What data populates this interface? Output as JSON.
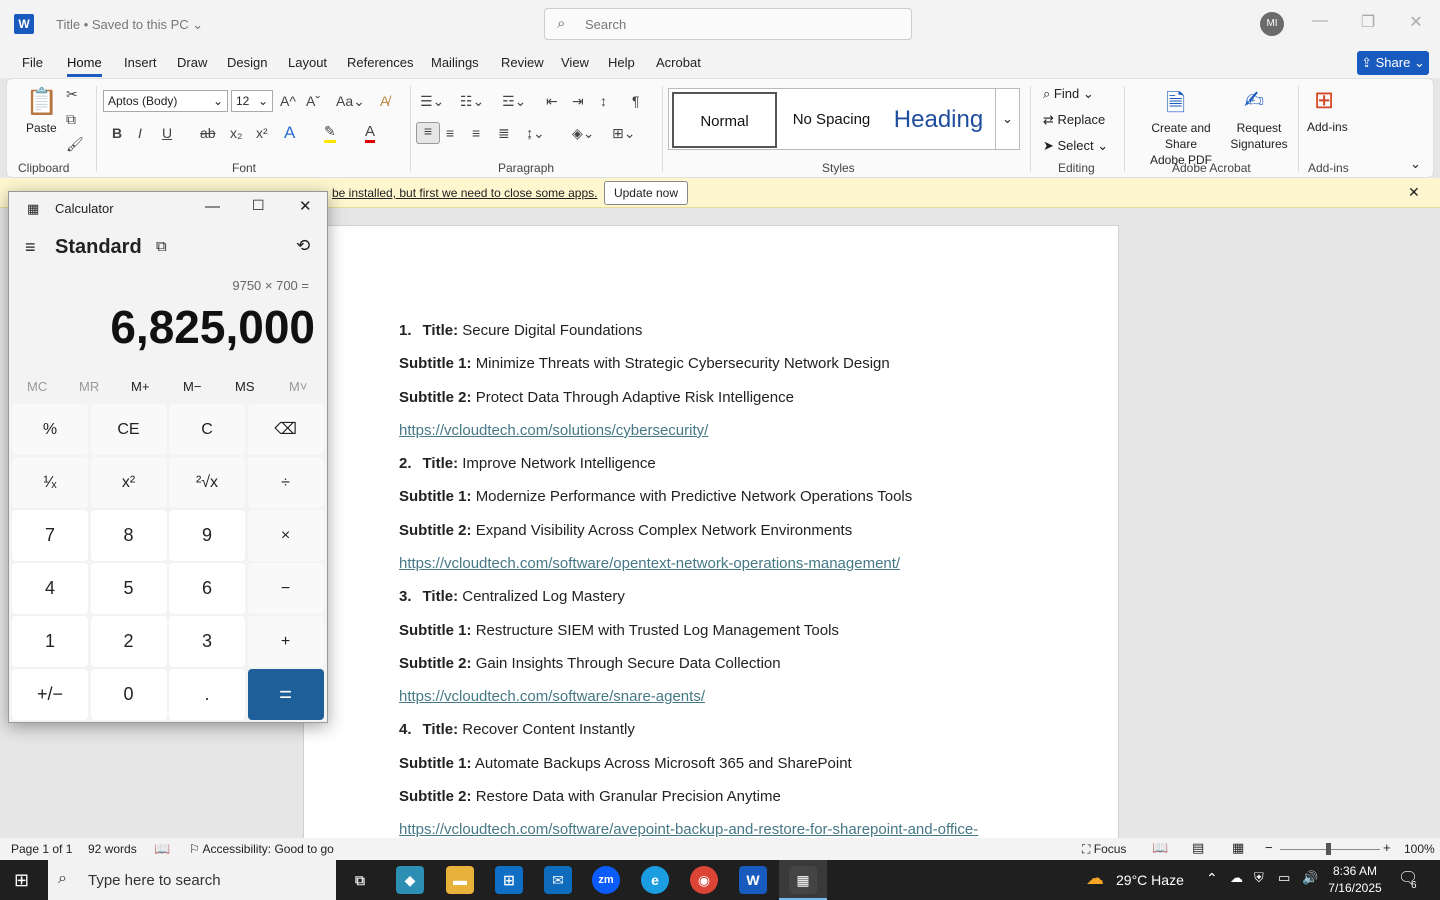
{
  "word": {
    "title": "Title • Saved to this PC ⌄",
    "search_placeholder": "Search",
    "avatar": "MI",
    "menus": [
      "File",
      "Home",
      "Insert",
      "Draw",
      "Design",
      "Layout",
      "References",
      "Mailings",
      "Review",
      "View",
      "Help",
      "Acrobat"
    ],
    "share_label": "Share",
    "ribbon": {
      "paste": "Paste",
      "font_name": "Aptos (Body)",
      "font_size": "12",
      "groups": {
        "clipboard": "Clipboard",
        "font": "Font",
        "paragraph": "Paragraph",
        "styles": "Styles",
        "editing": "Editing",
        "adobe": "Adobe Acrobat",
        "addins": "Add-ins"
      },
      "styles": [
        "Normal",
        "No Spacing",
        "Heading"
      ],
      "find": "Find",
      "replace": "Replace",
      "select": "Select",
      "create_pdf": [
        "Create and Share",
        "Adobe PDF"
      ],
      "request_sig": [
        "Request",
        "Signatures"
      ],
      "addins": "Add-ins"
    },
    "notice": {
      "text": "be installed, but first we need to close some apps.",
      "button": "Update now"
    },
    "doc": [
      {
        "num": "1.",
        "label": "Title:",
        "text": "Secure Digital Foundations"
      },
      {
        "label": "Subtitle 1:",
        "text": "Minimize Threats with Strategic Cybersecurity Network Design"
      },
      {
        "label": "Subtitle 2:",
        "text": "Protect Data Through Adaptive Risk Intelligence"
      },
      {
        "link": "https://vcloudtech.com/solutions/cybersecurity/"
      },
      {
        "num": "2.",
        "label": "Title:",
        "text": "Improve Network Intelligence"
      },
      {
        "label": "Subtitle 1:",
        "text": "Modernize Performance with Predictive Network Operations Tools"
      },
      {
        "label": "Subtitle 2:",
        "text": "Expand Visibility Across Complex Network Environments"
      },
      {
        "link": "https://vcloudtech.com/software/opentext-network-operations-management/"
      },
      {
        "num": "3.",
        "label": "Title:",
        "text": "Centralized Log Mastery"
      },
      {
        "label": "Subtitle 1:",
        "text": "Restructure SIEM with Trusted Log Management Tools"
      },
      {
        "label": "Subtitle 2:",
        "text": "Gain Insights Through Secure Data Collection"
      },
      {
        "link": "https://vcloudtech.com/software/snare-agents/"
      },
      {
        "num": "4.",
        "label": "Title:",
        "text": "Recover Content Instantly"
      },
      {
        "label": "Subtitle 1:",
        "text": "Automate Backups Across Microsoft 365 and SharePoint"
      },
      {
        "label": "Subtitle 2:",
        "text": "Restore Data with Granular Precision Anytime"
      },
      {
        "link": "https://vcloudtech.com/software/avepoint-backup-and-restore-for-sharepoint-and-office-"
      }
    ],
    "status": {
      "page": "Page 1 of 1",
      "words": "92 words",
      "accessibility": "Accessibility: Good to go",
      "focus": "Focus",
      "zoom": "100%"
    }
  },
  "calculator": {
    "title": "Calculator",
    "mode": "Standard",
    "expression": "9750 × 700 =",
    "display": "6,825,000",
    "memory": [
      "MC",
      "MR",
      "M+",
      "M−",
      "MS",
      "M˅"
    ],
    "keys": [
      [
        "%",
        "CE",
        "C",
        "⌫"
      ],
      [
        "¹⁄ₓ",
        "x²",
        "²√x",
        "÷"
      ],
      [
        "7",
        "8",
        "9",
        "×"
      ],
      [
        "4",
        "5",
        "6",
        "−"
      ],
      [
        "1",
        "2",
        "3",
        "+"
      ],
      [
        "+/−",
        "0",
        ".",
        "="
      ]
    ]
  },
  "taskbar": {
    "search_placeholder": "Type here to search",
    "weather": "29°C  Haze",
    "time": "8:36 AM",
    "date": "7/16/2025",
    "notif_count": "6"
  }
}
